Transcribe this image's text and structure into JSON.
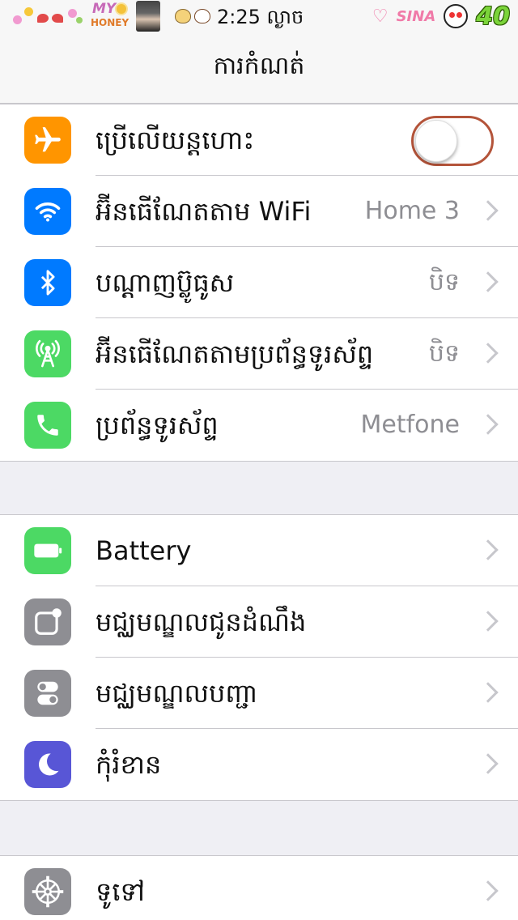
{
  "status_bar": {
    "time": "2:25 ល្ងាច",
    "my_text": "MY",
    "honey_text": "HONEY",
    "sina_text": "SINA",
    "battery_level": "40"
  },
  "nav": {
    "title": "ការកំណត់"
  },
  "groups": [
    {
      "rows": [
        {
          "label": "ប្រើលើយន្តហោះ",
          "icon": "airplane-icon",
          "color": "#ff9500",
          "control": "toggle",
          "on": false
        },
        {
          "label": "អ៊ីនធើណែតតាម WiFi",
          "value": "Home 3",
          "icon": "wifi-icon",
          "color": "#007aff"
        },
        {
          "label": "បណ្តាញប៊្លូធូស",
          "value": "បិទ",
          "icon": "bluetooth-icon",
          "color": "#007aff"
        },
        {
          "label": "អ៊ីនធើណែតតាមប្រព័ន្ធទូរស័ព្ទ",
          "value": "បិទ",
          "icon": "cellular-antenna-icon",
          "color": "#4cd964"
        },
        {
          "label": "ប្រព័ន្ធទូរស័ព្ទ",
          "value": "Metfone",
          "icon": "phone-icon",
          "color": "#4cd964"
        }
      ]
    },
    {
      "rows": [
        {
          "label": "Battery",
          "icon": "battery-icon",
          "color": "#4cd964"
        },
        {
          "label": "មជ្ឈមណ្ឌលជូនដំណឹង",
          "icon": "notification-center-icon",
          "color": "#8e8e93"
        },
        {
          "label": "មជ្ឈមណ្ឌលបញ្ជា",
          "icon": "control-center-icon",
          "color": "#8e8e93"
        },
        {
          "label": "កុំរំខាន",
          "icon": "moon-icon",
          "color": "#5856d6"
        }
      ]
    },
    {
      "rows": [
        {
          "label": "ទូទៅ",
          "icon": "gear-icon",
          "color": "#8e8e93"
        }
      ]
    }
  ]
}
